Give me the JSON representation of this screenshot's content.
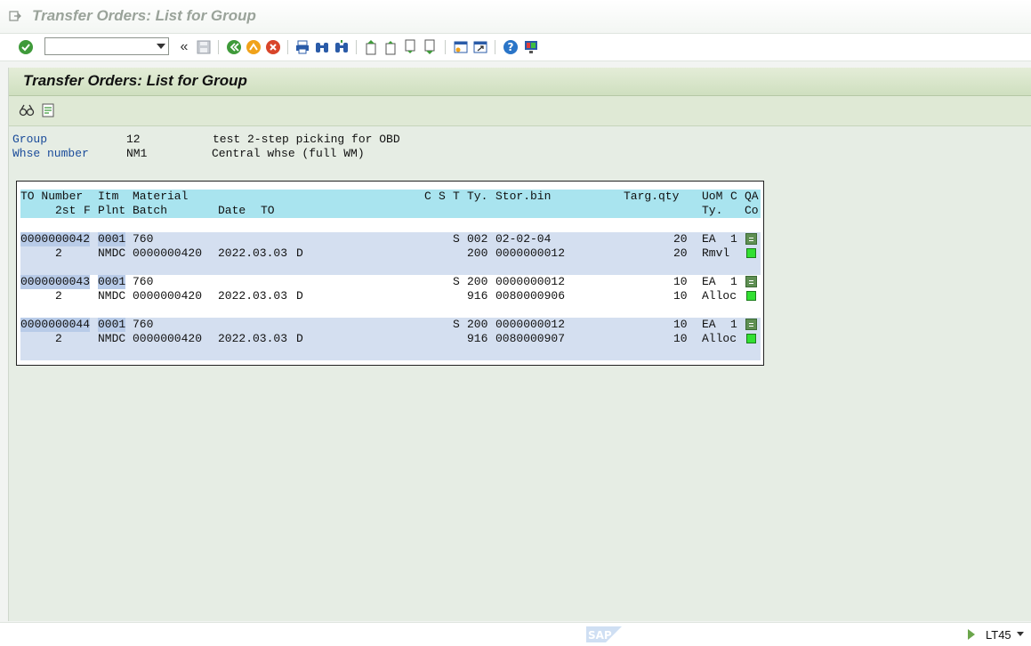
{
  "window": {
    "title": "Transfer Orders: List for Group"
  },
  "toolbar": {
    "command_value": ""
  },
  "page": {
    "title": "Transfer Orders: List for Group"
  },
  "info": {
    "group_label": "Group",
    "group_value": "12",
    "group_desc": "test 2-step picking for OBD",
    "whse_label": "Whse number",
    "whse_value": "NM1",
    "whse_desc": "Central whse (full WM)"
  },
  "columns": {
    "r1": {
      "to_number": "TO Number",
      "itm": "Itm",
      "material": "Material",
      "c": "C",
      "s": "S",
      "t": "T",
      "ty": "Ty.",
      "storbin": "Stor.bin",
      "targ": "Targ.qty",
      "uom": "UoM",
      "c2": "C",
      "qa": "QA"
    },
    "r2": {
      "second": "2st",
      "f": "F",
      "plnt": "Plnt",
      "batch": "Batch",
      "date": "Date",
      "to": "TO",
      "ty": "Ty.",
      "co": "Co"
    }
  },
  "orders": [
    {
      "to_number": "0000000042",
      "itm": "0001",
      "material": "760",
      "s": "S",
      "ty": "002",
      "storbin": "02-02-04",
      "qty": "20",
      "uom": "EA",
      "c": "1",
      "second": "2",
      "plnt": "NMDC",
      "batch": "0000000420",
      "date": "2022.03.03",
      "to": "D",
      "ty2": "200",
      "storbin2": "0000000012",
      "qty2": "20",
      "ty_text": "Rmvl"
    },
    {
      "to_number": "0000000043",
      "itm": "0001",
      "material": "760",
      "s": "S",
      "ty": "200",
      "storbin": "0000000012",
      "qty": "10",
      "uom": "EA",
      "c": "1",
      "second": "2",
      "plnt": "NMDC",
      "batch": "0000000420",
      "date": "2022.03.03",
      "to": "D",
      "ty2": "916",
      "storbin2": "0080000906",
      "qty2": "10",
      "ty_text": "Alloc"
    },
    {
      "to_number": "0000000044",
      "itm": "0001",
      "material": "760",
      "s": "S",
      "ty": "200",
      "storbin": "0000000012",
      "qty": "10",
      "uom": "EA",
      "c": "1",
      "second": "2",
      "plnt": "NMDC",
      "batch": "0000000420",
      "date": "2022.03.03",
      "to": "D",
      "ty2": "916",
      "storbin2": "0080000907",
      "qty2": "10",
      "ty_text": "Alloc"
    }
  ],
  "status": {
    "tcode": "LT45",
    "logo_text": "SAP"
  }
}
